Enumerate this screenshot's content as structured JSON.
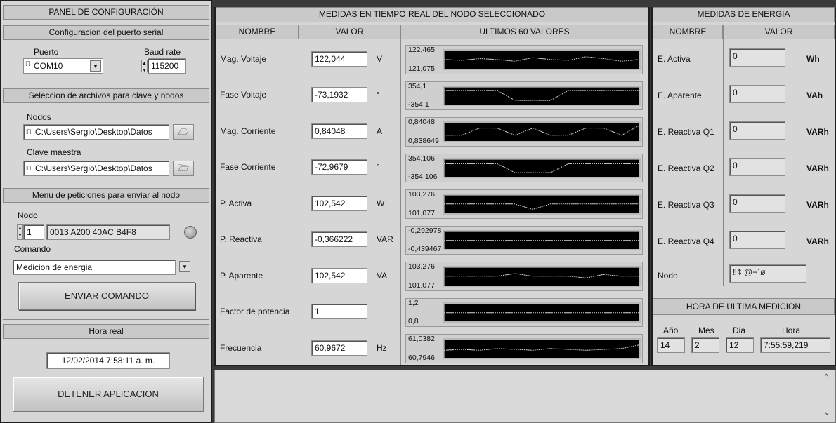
{
  "left": {
    "title": "PANEL DE CONFIGURACIÓN",
    "serial_header": "Configuracion del puerto serial",
    "port_label": "Puerto",
    "port_value": "COM10",
    "baud_label": "Baud rate",
    "baud_value": "115200",
    "files_header": "Seleccion de archivos para clave y nodos",
    "nodes_label": "Nodos",
    "nodes_path": "C:\\Users\\Sergio\\Desktop\\Datos",
    "key_label": "Clave maestra",
    "key_path": "C:\\Users\\Sergio\\Desktop\\Datos",
    "menu_header": "Menu de peticiones para enviar al nodo",
    "node_label": "Nodo",
    "node_number": "1",
    "node_address": "0013 A200 40AC B4F8",
    "command_label": "Comando",
    "command_value": "Medicion de energia",
    "send_button": "ENVIAR COMANDO",
    "realtime_header": "Hora real",
    "realtime_value": "12/02/2014 7:58:11 a. m.",
    "stop_button": "DETENER APLICACION"
  },
  "middle": {
    "title": "MEDIDAS EN TIEMPO REAL DEL NODO SELECCIONADO",
    "col_name": "NOMBRE",
    "col_value": "VALOR",
    "col_last": "ULTIMOS 60 VALORES",
    "rows": [
      {
        "name": "Mag. Voltaje",
        "value": "122,044",
        "unit": "V",
        "gmax": "122,465",
        "gmin": "121,075"
      },
      {
        "name": "Fase Voltaje",
        "value": "-73,1932",
        "unit": "°",
        "gmax": "354,1",
        "gmin": "-354,1"
      },
      {
        "name": "Mag. Corriente",
        "value": "0,84048",
        "unit": "A",
        "gmax": "0,84048",
        "gmin": "0,838649"
      },
      {
        "name": "Fase Corriente",
        "value": "-72,9679",
        "unit": "°",
        "gmax": "354,106",
        "gmin": "-354,106"
      },
      {
        "name": "P. Activa",
        "value": "102,542",
        "unit": "W",
        "gmax": "103,276",
        "gmin": "101,077"
      },
      {
        "name": "P. Reactiva",
        "value": "-0,366222",
        "unit": "VAR",
        "gmax": "-0,292978",
        "gmin": "-0,439467"
      },
      {
        "name": "P. Aparente",
        "value": "102,542",
        "unit": "VA",
        "gmax": "103,276",
        "gmin": "101,077"
      },
      {
        "name": "Factor de potencia",
        "value": "1",
        "unit": "",
        "gmax": "1,2",
        "gmin": "0,8"
      },
      {
        "name": "Frecuencia",
        "value": "60,9672",
        "unit": "Hz",
        "gmax": "61,0382",
        "gmin": "60,7946"
      }
    ]
  },
  "right": {
    "title": "MEDIDAS DE ENERGIA",
    "col_name": "NOMBRE",
    "col_value": "VALOR",
    "rows": [
      {
        "name": "E. Activa",
        "value": "0",
        "unit": "Wh"
      },
      {
        "name": "E. Aparente",
        "value": "0",
        "unit": "VAh"
      },
      {
        "name": "E. Reactiva Q1",
        "value": "0",
        "unit": "VARh"
      },
      {
        "name": "E. Reactiva Q2",
        "value": "0",
        "unit": "VARh"
      },
      {
        "name": "E. Reactiva Q3",
        "value": "0",
        "unit": "VARh"
      },
      {
        "name": "E. Reactiva Q4",
        "value": "0",
        "unit": "VARh"
      }
    ],
    "node_label": "Nodo",
    "node_value": "‼¢ @¬´ø",
    "last_header": "HORA DE ULTIMA MEDICION",
    "year_label": "Año",
    "month_label": "Mes",
    "day_label": "Dia",
    "hour_label": "Hora",
    "year": "14",
    "month": "2",
    "day": "12",
    "hour": "7:55:59,219"
  },
  "colors": {
    "panel": "#d6d6d6",
    "header": "#c9c9c9",
    "graph_bg": "#000000",
    "trace": "#d8d8d8"
  }
}
